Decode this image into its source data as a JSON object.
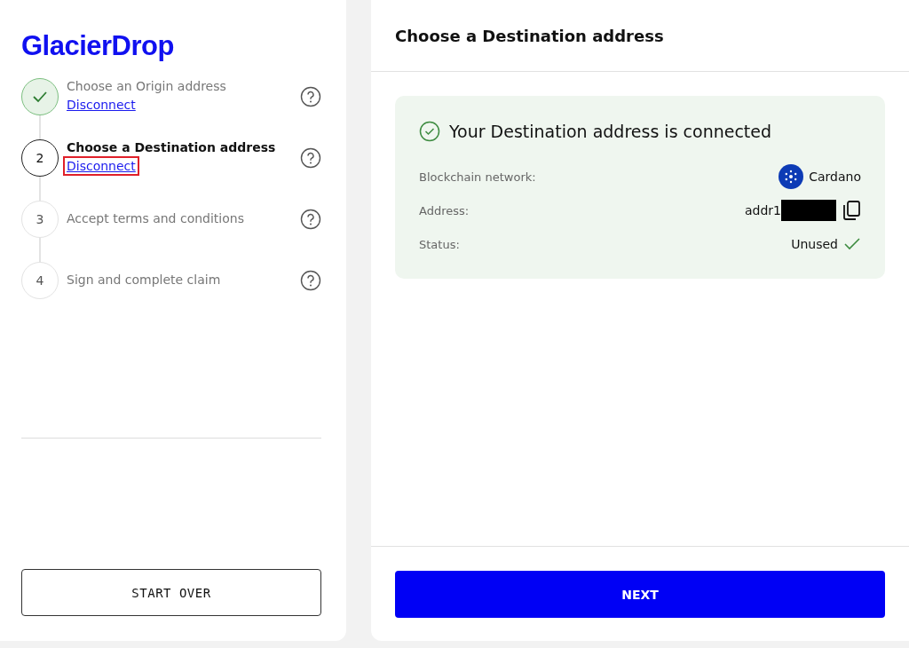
{
  "logo": "GlacierDrop",
  "steps": [
    {
      "label": "Choose an Origin address",
      "completed": true,
      "current": false,
      "link": "Disconnect",
      "highlighted": false
    },
    {
      "number": "2",
      "label": "Choose a Destination address",
      "completed": false,
      "current": true,
      "link": "Disconnect",
      "highlighted": true
    },
    {
      "number": "3",
      "label": "Accept terms and conditions",
      "completed": false,
      "current": false
    },
    {
      "number": "4",
      "label": "Sign and complete claim",
      "completed": false,
      "current": false
    }
  ],
  "start_over": "START OVER",
  "panel_title": "Choose a Destination address",
  "status_card": {
    "heading": "Your Destination address is connected",
    "rows": [
      {
        "kind": "network",
        "label": "Blockchain network:",
        "value": "Cardano"
      },
      {
        "kind": "address",
        "label": "Address:",
        "value": "addr1",
        "redacted": true
      },
      {
        "kind": "status",
        "label": "Status:",
        "value": "Unused"
      }
    ]
  },
  "next": "NEXT"
}
